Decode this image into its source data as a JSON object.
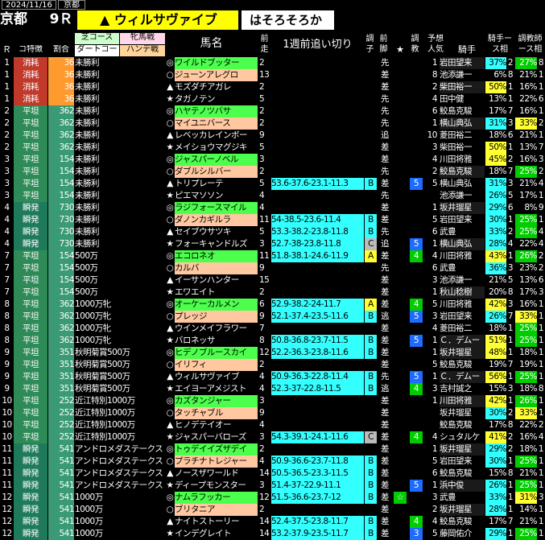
{
  "date": "2024/11/16",
  "venue_small": "京都",
  "venue": "京都",
  "race": "9Ｒ",
  "pick": "▲ ウィルサヴァイブ",
  "comment": "はそろそろか",
  "headers": {
    "r": "Ｒ",
    "course": "コ特徴",
    "ratio": "割合",
    "turf": "芝コース",
    "dirt": "ダートコー",
    "filly": "牝馬戦",
    "handicap": "ハンデ戦",
    "horse": "馬名",
    "prev_pos": "前走",
    "workout": "1週前追い切り",
    "cond": "調子",
    "leg": "前脚",
    "star": "★",
    "train": "調教",
    "pop": "予想人気",
    "jockey": "騎手",
    "jrate": "騎手ース相",
    "trate": "調教師ース相"
  },
  "colors": {
    "consume": "#c0392b",
    "flat": "#2e8b57",
    "fast": "#1f7a5c",
    "orange": "#ff9a2e",
    "teal": "#3a9a76",
    "magenta": "#c0317e",
    "peach": "#ffc8a0",
    "yellow": "#ffff33",
    "lime": "#4cff4c",
    "cyan": "#33ffff",
    "green": "#00cc00",
    "blue": "#1e6bff"
  },
  "rows": [
    {
      "r": "1",
      "c": "消耗",
      "p": "36",
      "cls": "未勝利",
      "m": "◎",
      "h": "ワイルドブッター",
      "pp": "2",
      "w": "",
      "wc": "",
      "cd": "",
      "lg": "先",
      "st": "",
      "tr": "",
      "pop": "1",
      "j": "岩田望来",
      "jr": "37%",
      "j2": "2",
      "tr1": "27%",
      "t2": "8"
    },
    {
      "r": "1",
      "c": "消耗",
      "p": "36",
      "cls": "未勝利",
      "m": "○",
      "h": "ジューンアレグロ",
      "pp": "13",
      "w": "",
      "wc": "",
      "cd": "",
      "lg": "差",
      "st": "",
      "tr": "",
      "pop": "8",
      "j": "池添謙一",
      "jr": "6%",
      "j2": "8",
      "tr1": "21%",
      "t2": "1"
    },
    {
      "r": "1",
      "c": "消耗",
      "p": "36",
      "cls": "未勝利",
      "m": "▲",
      "h": "モズダチアガレ",
      "pp": "2",
      "w": "",
      "wc": "",
      "cd": "",
      "lg": "差",
      "st": "",
      "tr": "",
      "pop": "2",
      "j": "柴田裕一",
      "jr": "50%",
      "j2": "1",
      "tr1": "16%",
      "t2": "1"
    },
    {
      "r": "1",
      "c": "消耗",
      "p": "36",
      "cls": "未勝利",
      "m": "★",
      "h": "タガノテン",
      "pp": "5",
      "w": "",
      "wc": "",
      "cd": "",
      "lg": "先",
      "st": "",
      "tr": "",
      "pop": "4",
      "j": "田中健",
      "jr": "13%",
      "j2": "1",
      "tr1": "22%",
      "t2": "6"
    },
    {
      "r": "2",
      "c": "平坦",
      "p": "362",
      "cls": "未勝利",
      "m": "◎",
      "h": "ハヤテノツバサ",
      "pp": "2",
      "w": "",
      "wc": "",
      "cd": "",
      "lg": "先",
      "st": "",
      "tr": "",
      "pop": "6",
      "j": "鮫島克駿",
      "jr": "17%",
      "j2": "7",
      "tr1": "16%",
      "t2": "1"
    },
    {
      "r": "2",
      "c": "平坦",
      "p": "362",
      "cls": "未勝利",
      "m": "○",
      "h": "マイユニバース",
      "pp": "2",
      "w": "",
      "wc": "",
      "cd": "",
      "lg": "先",
      "st": "",
      "tr": "",
      "pop": "1",
      "j": "横山典弘",
      "jr": "31%",
      "j2": "3",
      "tr1": "33%",
      "t2": "2"
    },
    {
      "r": "2",
      "c": "平坦",
      "p": "362",
      "cls": "未勝利",
      "m": "▲",
      "h": "レベッカレインボー",
      "pp": "9",
      "w": "",
      "wc": "",
      "cd": "",
      "lg": "追",
      "st": "",
      "tr": "",
      "pop": "10",
      "j": "菱田裕二",
      "jr": "18%",
      "j2": "6",
      "tr1": "21%",
      "t2": "1"
    },
    {
      "r": "2",
      "c": "平坦",
      "p": "362",
      "cls": "未勝利",
      "m": "★",
      "h": "メイショウマグジキ",
      "pp": "5",
      "w": "",
      "wc": "",
      "cd": "",
      "lg": "差",
      "st": "",
      "tr": "",
      "pop": "3",
      "j": "柴田裕一",
      "jr": "50%",
      "j2": "1",
      "tr1": "13%",
      "t2": "7"
    },
    {
      "r": "3",
      "c": "平坦",
      "p": "154",
      "cls": "未勝利",
      "m": "◎",
      "h": "ジャスパーノベル",
      "pp": "3",
      "w": "",
      "wc": "",
      "cd": "",
      "lg": "差",
      "st": "",
      "tr": "",
      "pop": "4",
      "j": "川田将雅",
      "jr": "45%",
      "j2": "2",
      "tr1": "16%",
      "t2": "3"
    },
    {
      "r": "3",
      "c": "平坦",
      "p": "154",
      "cls": "未勝利",
      "m": "○",
      "h": "ダブルシルバー",
      "pp": "2",
      "w": "",
      "wc": "",
      "cd": "",
      "lg": "先",
      "st": "",
      "tr": "",
      "pop": "2",
      "j": "鮫島克駿",
      "jr": "18%",
      "j2": "7",
      "tr1": "25%",
      "t2": "2"
    },
    {
      "r": "3",
      "c": "平坦",
      "p": "154",
      "cls": "未勝利",
      "m": "▲",
      "h": "トリプレーテ",
      "pp": "5",
      "w": "53.6-37.6-23.1-11.3",
      "wc": "",
      "cd": "B",
      "lg": "差",
      "st": "",
      "tr": "5",
      "pop": "5",
      "j": "横山典弘",
      "jr": "31%",
      "j2": "3",
      "tr1": "21%",
      "t2": "4"
    },
    {
      "r": "3",
      "c": "平坦",
      "p": "154",
      "cls": "未勝利",
      "m": "★",
      "h": "ピエマソソン",
      "pp": "4",
      "w": "",
      "wc": "",
      "cd": "",
      "lg": "先",
      "st": "",
      "tr": "",
      "pop": "",
      "j": "池添謙一",
      "jr": "26%",
      "j2": "5",
      "tr1": "17%",
      "t2": "1"
    },
    {
      "r": "4",
      "c": "瞬発",
      "p": "730",
      "cls": "未勝利",
      "m": "◎",
      "h": "ラジフォースマイル",
      "pp": "4",
      "w": "",
      "wc": "",
      "cd": "",
      "lg": "差",
      "st": "",
      "tr": "",
      "pop": "1",
      "j": "坂井瑠星",
      "jr": "29%",
      "j2": "6",
      "tr1": "8%",
      "t2": "9"
    },
    {
      "r": "4",
      "c": "瞬発",
      "p": "730",
      "cls": "未勝利",
      "m": "○",
      "h": "ダノンカギルラ",
      "pp": "11",
      "w": "54-38.5-23.6-11.4",
      "wc": "",
      "cd": "B",
      "lg": "差",
      "st": "",
      "tr": "",
      "pop": "5",
      "j": "岩田望来",
      "jr": "30%",
      "j2": "1",
      "tr1": "25%",
      "t2": "1"
    },
    {
      "r": "4",
      "c": "瞬発",
      "p": "730",
      "cls": "未勝利",
      "m": "▲",
      "h": "セイブウサツキ",
      "pp": "5",
      "w": "53.3-38.2-23.8-11.8",
      "wc": "",
      "cd": "B",
      "lg": "先",
      "st": "",
      "tr": "",
      "pop": "6",
      "j": "武豊",
      "jr": "33%",
      "j2": "2",
      "tr1": "25%",
      "t2": "4"
    },
    {
      "r": "4",
      "c": "瞬発",
      "p": "730",
      "cls": "未勝利",
      "m": "★",
      "h": "フォーキャンドルズ",
      "pp": "3",
      "w": "52.7-38-23.8-11.8",
      "wc": "",
      "cd": "C",
      "lg": "追",
      "st": "",
      "tr": "5",
      "pop": "1",
      "j": "横山典弘",
      "jr": "28%",
      "j2": "4",
      "tr1": "22%",
      "t2": "4"
    },
    {
      "r": "7",
      "c": "平坦",
      "p": "154",
      "cls": "500万",
      "m": "◎",
      "h": "エコロネオ",
      "pp": "11",
      "w": "51.8-38.1-24.6-11.9",
      "wc": "",
      "cd": "A",
      "lg": "差",
      "st": "",
      "tr": "4",
      "pop": "4",
      "j": "川田将雅",
      "jr": "43%",
      "j2": "1",
      "tr1": "26%",
      "t2": "2"
    },
    {
      "r": "7",
      "c": "平坦",
      "p": "154",
      "cls": "500万",
      "m": "○",
      "h": "カルバ",
      "pp": "9",
      "w": "",
      "wc": "",
      "cd": "",
      "lg": "先",
      "st": "",
      "tr": "",
      "pop": "6",
      "j": "武豊",
      "jr": "36%",
      "j2": "3",
      "tr1": "23%",
      "t2": "2"
    },
    {
      "r": "7",
      "c": "平坦",
      "p": "154",
      "cls": "500万",
      "m": "▲",
      "h": "イーサンハンター",
      "pp": "15",
      "w": "",
      "wc": "",
      "cd": "",
      "lg": "差",
      "st": "",
      "tr": "",
      "pop": "3",
      "j": "池添謙一",
      "jr": "21%",
      "j2": "5",
      "tr1": "13%",
      "t2": "6"
    },
    {
      "r": "7",
      "c": "平坦",
      "p": "154",
      "cls": "500万",
      "m": "★",
      "h": "エワエイト",
      "pp": "2",
      "w": "",
      "wc": "",
      "cd": "",
      "lg": "差",
      "st": "",
      "tr": "",
      "pop": "1",
      "j": "秋山稔樹",
      "jr": "20%",
      "j2": "8",
      "tr1": "17%",
      "t2": "3"
    },
    {
      "r": "8",
      "c": "平坦",
      "p": "362",
      "cls": "1000万牝",
      "m": "◎",
      "h": "オーケーカルメン",
      "pp": "6",
      "w": "52.9-38.2-24-11.7",
      "wc": "",
      "cd": "A",
      "lg": "差",
      "st": "",
      "tr": "4",
      "pop": "5",
      "j": "川田将雅",
      "jr": "42%",
      "j2": "3",
      "tr1": "16%",
      "t2": "1"
    },
    {
      "r": "8",
      "c": "平坦",
      "p": "362",
      "cls": "1000万牝",
      "m": "○",
      "h": "プレッジ",
      "pp": "9",
      "w": "52.1-37.4-23.5-11.6",
      "wc": "",
      "cd": "B",
      "lg": "逃",
      "st": "",
      "tr": "5",
      "pop": "3",
      "j": "岩田望来",
      "jr": "26%",
      "j2": "7",
      "tr1": "33%",
      "t2": "1"
    },
    {
      "r": "8",
      "c": "平坦",
      "p": "362",
      "cls": "1000万牝",
      "m": "▲",
      "h": "ウインメイフラワー",
      "pp": "7",
      "w": "",
      "wc": "",
      "cd": "",
      "lg": "差",
      "st": "",
      "tr": "",
      "pop": "4",
      "j": "菱田裕二",
      "jr": "18%",
      "j2": "1",
      "tr1": "25%",
      "t2": "1"
    },
    {
      "r": "8",
      "c": "平坦",
      "p": "362",
      "cls": "1000万牝",
      "m": "★",
      "h": "バロネッサ",
      "pp": "8",
      "w": "50.8-36.8-23.7-11.5",
      "wc": "",
      "cd": "B",
      "lg": "差",
      "st": "",
      "tr": "5",
      "pop": "1",
      "j": "Ｃ．デムー",
      "jr": "51%",
      "j2": "1",
      "tr1": "25%",
      "t2": "1"
    },
    {
      "r": "9",
      "c": "平坦",
      "p": "351",
      "cls": "秋明菊賞500万",
      "m": "◎",
      "h": "ヒデノブルースカイ",
      "pp": "12",
      "w": "52.2-36.3-23.8-11.6",
      "wc": "",
      "cd": "B",
      "lg": "差",
      "st": "",
      "tr": "",
      "pop": "1",
      "j": "坂井瑠星",
      "jr": "48%",
      "j2": "1",
      "tr1": "18%",
      "t2": "1"
    },
    {
      "r": "9",
      "c": "平坦",
      "p": "351",
      "cls": "秋明菊賞500万",
      "m": "○",
      "h": "イリフィ",
      "pp": "2",
      "w": "",
      "wc": "",
      "cd": "",
      "lg": "差",
      "st": "",
      "tr": "",
      "pop": "5",
      "j": "鮫島克駿",
      "jr": "19%",
      "j2": "7",
      "tr1": "19%",
      "t2": "1"
    },
    {
      "r": "9",
      "c": "平坦",
      "p": "351",
      "cls": "秋明菊賞500万",
      "m": "▲",
      "h": "ウィルサヴァイブ",
      "pp": "4",
      "w": "50.9-36.3-22.8-11.4",
      "wc": "",
      "cd": "B",
      "lg": "先",
      "st": "",
      "tr": "5",
      "pop": "1",
      "j": "Ｃ．デムー",
      "jr": "56%",
      "j2": "1",
      "tr1": "25%",
      "t2": "1"
    },
    {
      "r": "9",
      "c": "平坦",
      "p": "351",
      "cls": "秋明菊賞500万",
      "m": "★",
      "h": "エイヨーアメジスト",
      "pp": "4",
      "w": "52.3-37-22.8-11.5",
      "wc": "",
      "cd": "B",
      "lg": "逃",
      "st": "",
      "tr": "4",
      "pop": "3",
      "j": "吉村誠之",
      "jr": "15%",
      "j2": "3",
      "tr1": "18%",
      "t2": "8"
    },
    {
      "r": "10",
      "c": "平坦",
      "p": "252",
      "cls": "近江特別1000万",
      "m": "◎",
      "h": "カズタンジャー",
      "pp": "3",
      "w": "",
      "wc": "",
      "cd": "",
      "lg": "差",
      "st": "",
      "tr": "",
      "pop": "1",
      "j": "川田将雅",
      "jr": "42%",
      "j2": "1",
      "tr1": "26%",
      "t2": "1"
    },
    {
      "r": "10",
      "c": "平坦",
      "p": "252",
      "cls": "近江特別1000万",
      "m": "○",
      "h": "タッチャブル",
      "pp": "9",
      "w": "",
      "wc": "",
      "cd": "",
      "lg": "差",
      "st": "",
      "tr": "",
      "pop": "",
      "j": "坂井瑠星",
      "jr": "30%",
      "j2": "2",
      "tr1": "33%",
      "t2": "1"
    },
    {
      "r": "10",
      "c": "平坦",
      "p": "252",
      "cls": "近江特別1000万",
      "m": "▲",
      "h": "ヒノデテイオー",
      "pp": "4",
      "w": "",
      "wc": "",
      "cd": "",
      "lg": "差",
      "st": "",
      "tr": "",
      "pop": "",
      "j": "鮫島克駿",
      "jr": "17%",
      "j2": "8",
      "tr1": "22%",
      "t2": "2"
    },
    {
      "r": "10",
      "c": "平坦",
      "p": "252",
      "cls": "近江特別1000万",
      "m": "★",
      "h": "ジャスパーバローズ",
      "pp": "3",
      "w": "54.3-39.1-24.1-11.6",
      "wc": "",
      "cd": "C",
      "lg": "差",
      "st": "",
      "tr": "4",
      "pop": "4",
      "j": "シュタルケ",
      "jr": "41%",
      "j2": "2",
      "tr1": "16%",
      "t2": "4"
    },
    {
      "r": "11",
      "c": "瞬発",
      "p": "541",
      "cls": "アンドロメダステークス",
      "m": "◎",
      "h": "トゥデイイズザデイ",
      "pp": "2",
      "w": "",
      "wc": "",
      "cd": "",
      "lg": "差",
      "st": "",
      "tr": "",
      "pop": "1",
      "j": "坂井瑠星",
      "jr": "29%",
      "j2": "2",
      "tr1": "18%",
      "t2": "1"
    },
    {
      "r": "11",
      "c": "瞬発",
      "p": "541",
      "cls": "アンドロメダステークス",
      "m": "○",
      "h": "プラチナトレジャー",
      "pp": "4",
      "w": "50.9-36.6-23.7-11.8",
      "wc": "",
      "cd": "B",
      "lg": "差",
      "st": "",
      "tr": "",
      "pop": "5",
      "j": "岩田望来",
      "jr": "30%",
      "j2": "1",
      "tr1": "25%",
      "t2": "1"
    },
    {
      "r": "11",
      "c": "瞬発",
      "p": "541",
      "cls": "アンドロメダステークス",
      "m": "▲",
      "h": "ノースザワールド",
      "pp": "14",
      "w": "50.5-36.5-23.3-11.5",
      "wc": "",
      "cd": "B",
      "lg": "差",
      "st": "",
      "tr": "",
      "pop": "6",
      "j": "鮫島克駿",
      "jr": "15%",
      "j2": "8",
      "tr1": "21%",
      "t2": "1"
    },
    {
      "r": "11",
      "c": "瞬発",
      "p": "541",
      "cls": "アンドロメダステークス",
      "m": "★",
      "h": "ディープモンスター",
      "pp": "3",
      "w": "51.4-37-22.9-11.1",
      "wc": "",
      "cd": "B",
      "lg": "差",
      "st": "",
      "tr": "5",
      "pop": "1",
      "j": "浜中俊",
      "jr": "26%",
      "j2": "1",
      "tr1": "25%",
      "t2": "1"
    },
    {
      "r": "12",
      "c": "瞬発",
      "p": "541",
      "cls": "1000万",
      "m": "◎",
      "h": "ナムラフッカー",
      "pp": "12",
      "w": "51.5-36.6-23.7-12",
      "wc": "",
      "cd": "B",
      "lg": "差",
      "st": "☆",
      "tr": "",
      "pop": "3",
      "j": "武豊",
      "jr": "33%",
      "j2": "1",
      "tr1": "31%",
      "t2": "3"
    },
    {
      "r": "12",
      "c": "瞬発",
      "p": "541",
      "cls": "1000万",
      "m": "○",
      "h": "ブリタニア",
      "pp": "2",
      "w": "",
      "wc": "",
      "cd": "",
      "lg": "差",
      "st": "",
      "tr": "",
      "pop": "2",
      "j": "坂井瑠星",
      "jr": "28%",
      "j2": "1",
      "tr1": "14%",
      "t2": "1"
    },
    {
      "r": "12",
      "c": "瞬発",
      "p": "541",
      "cls": "1000万",
      "m": "▲",
      "h": "ナイトストーリー",
      "pp": "14",
      "w": "52.4-37.5-23.8-11.7",
      "wc": "",
      "cd": "B",
      "lg": "差",
      "st": "",
      "tr": "4",
      "pop": "4",
      "j": "鮫島克駿",
      "jr": "17%",
      "j2": "7",
      "tr1": "21%",
      "t2": "1"
    },
    {
      "r": "12",
      "c": "瞬発",
      "p": "541",
      "cls": "1000万",
      "m": "★",
      "h": "インデグレイト",
      "pp": "14",
      "w": "53.2-37.9-23.5-11.7",
      "wc": "",
      "cd": "B",
      "lg": "差",
      "st": "",
      "tr": "3",
      "pop": "5",
      "j": "藤岡佑介",
      "jr": "29%",
      "j2": "1",
      "tr1": "25%",
      "t2": "1"
    }
  ]
}
